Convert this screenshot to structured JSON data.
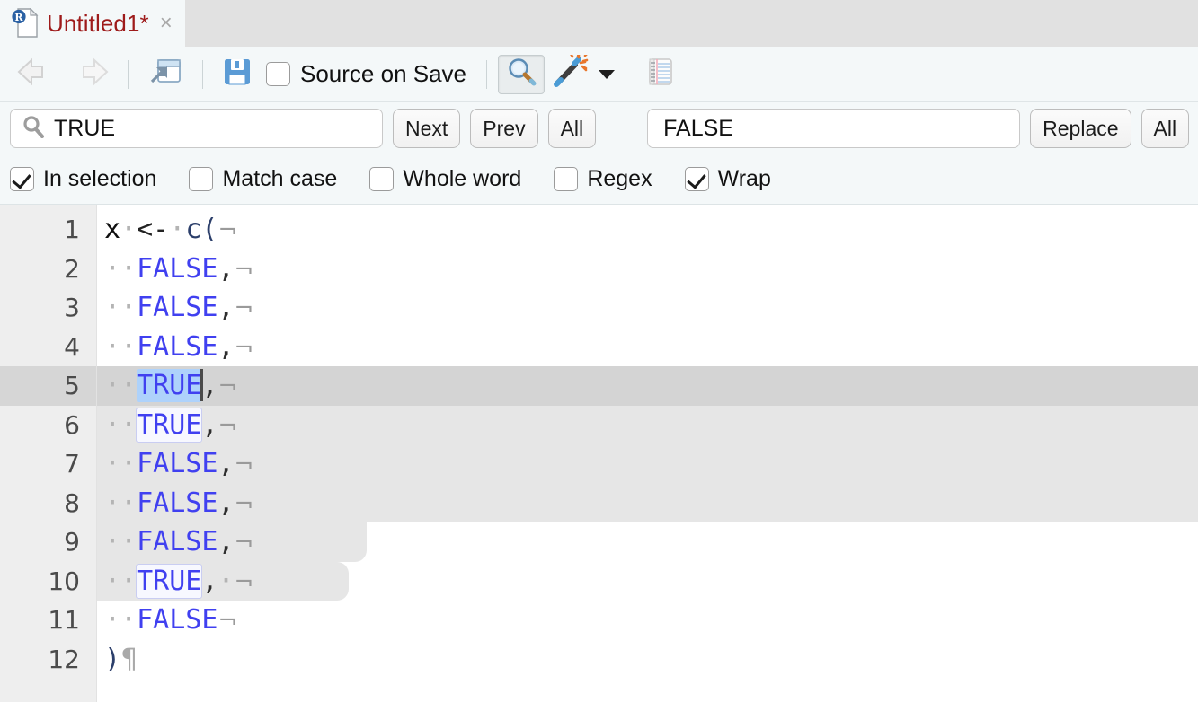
{
  "window": {
    "app": "RStudio Source Editor",
    "tab": {
      "title": "Untitled1*",
      "icon": "r-script-file-icon",
      "close_label": "×"
    }
  },
  "toolbar": {
    "back_icon": "back-arrow-icon",
    "forward_icon": "forward-arrow-icon",
    "popout_icon": "show-in-new-window-icon",
    "save_icon": "save-floppy-icon",
    "source_on_save": {
      "label": "Source on Save",
      "checked": false
    },
    "find_replace_icon": "magnifier-find-replace-icon",
    "find_replace_active": true,
    "code_tools_icon": "magic-wand-code-tools-icon",
    "code_tools_caret": "chevron-down-icon",
    "compile_report_icon": "notebook-compile-report-icon"
  },
  "find_bar": {
    "find_icon": "search-icon",
    "find_value": "TRUE",
    "find_placeholder": "Find",
    "next_label": "Next",
    "prev_label": "Prev",
    "all_label": "All",
    "replace_value": "FALSE",
    "replace_placeholder": "Replace",
    "replace_label": "Replace",
    "replace_all_label": "All"
  },
  "find_options": [
    {
      "label": "In selection",
      "checked": true
    },
    {
      "label": "Match case",
      "checked": false
    },
    {
      "label": "Whole word",
      "checked": false
    },
    {
      "label": "Regex",
      "checked": false
    },
    {
      "label": "Wrap",
      "checked": true
    }
  ],
  "editor": {
    "language": "R",
    "show_whitespace": true,
    "space_glyph": "·",
    "newline_glyph": "¬",
    "eof_glyph": "¶",
    "cursor_line": 5,
    "selection_lines": [
      5,
      6,
      7,
      8,
      9,
      10
    ],
    "colors": {
      "boolean": "#4040f0",
      "function": "#2c3f6b",
      "active_line_bg": "#d4d4d4",
      "selection_bg": "#e6e6e6",
      "match_active_bg": "#aed2fb",
      "gutter_bg": "#eeeeee"
    },
    "lines": [
      {
        "n": "1",
        "text": "x <- c("
      },
      {
        "n": "2",
        "text": "  FALSE,"
      },
      {
        "n": "3",
        "text": "  FALSE,"
      },
      {
        "n": "4",
        "text": "  FALSE,"
      },
      {
        "n": "5",
        "text": "  TRUE,"
      },
      {
        "n": "6",
        "text": "  TRUE,"
      },
      {
        "n": "7",
        "text": "  FALSE,"
      },
      {
        "n": "8",
        "text": "  FALSE,"
      },
      {
        "n": "9",
        "text": "  FALSE,"
      },
      {
        "n": "10",
        "text": "  TRUE, "
      },
      {
        "n": "11",
        "text": "  FALSE"
      },
      {
        "n": "12",
        "text": ")"
      }
    ],
    "line_numbers": [
      "1",
      "2",
      "3",
      "4",
      "5",
      "6",
      "7",
      "8",
      "9",
      "10",
      "11",
      "12"
    ],
    "gutter_line_1": "1",
    "gutter_line_2": "2",
    "gutter_line_3": "3",
    "gutter_line_4": "4",
    "gutter_line_5": "5",
    "gutter_line_6": "6",
    "gutter_line_7": "7",
    "gutter_line_8": "8",
    "gutter_line_9": "9",
    "gutter_line_10": "10",
    "gutter_line_11": "11",
    "gutter_line_12": "12",
    "code": {
      "l1_var": "x",
      "l1_op": "<-",
      "l1_fn": "c",
      "l1_paren": "(",
      "false_kw": "FALSE",
      "true_kw": "TRUE",
      "comma": ",",
      "close_paren": ")"
    }
  }
}
